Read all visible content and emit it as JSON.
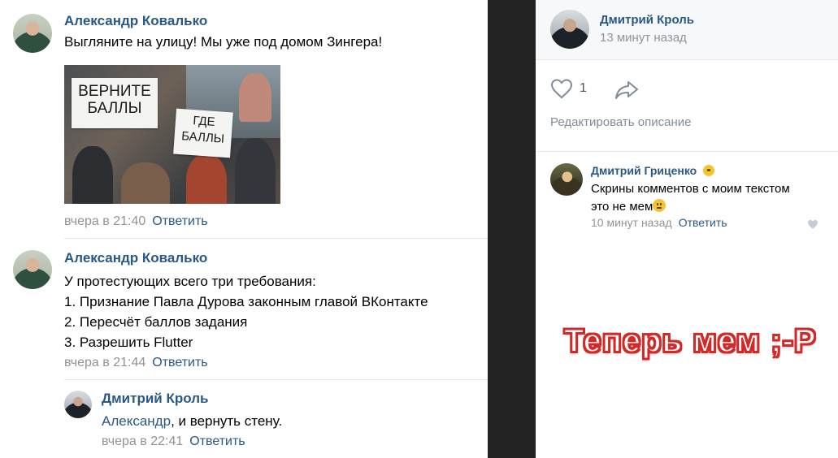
{
  "left": {
    "comment1": {
      "author": "Александр Ковалько",
      "text": "Выгляните на улицу! Мы уже под домом Зингера!",
      "photo_sign1": "ВЕРНИТЕ БАЛЛЫ",
      "photo_sign2": "ГДЕ БАЛЛЫ",
      "time": "вчера в 21:40",
      "reply": "Ответить"
    },
    "comment2": {
      "author": "Александр Ковалько",
      "lines": [
        "У протестующих всего три требования:",
        "1. Признание Павла Дурова законным главой ВКонтакте",
        "2. Пересчёт баллов задания",
        "3. Разрешить Flutter"
      ],
      "time": "вчера в 21:44",
      "reply": "Ответить"
    },
    "reply1": {
      "author": "Дмитрий Кроль",
      "mention": "Александр",
      "text": ", и вернуть стену.",
      "time": "вчера в 22:41",
      "reply": "Ответить"
    }
  },
  "right": {
    "post_author": "Дмитрий Кроль",
    "post_time": "13 минут назад",
    "likes": "1",
    "edit_description": "Редактировать описание",
    "comment": {
      "author": "Дмитрий Гриценко",
      "line1": "Скрины комментов с моим текстом",
      "line2": "это не мем",
      "time": "10 минут назад",
      "reply": "Ответить"
    }
  },
  "meme_caption": "Теперь мем ;-P",
  "colors": {
    "link": "#2a5885",
    "meta": "#939393",
    "caption_outline": "#d32828"
  }
}
